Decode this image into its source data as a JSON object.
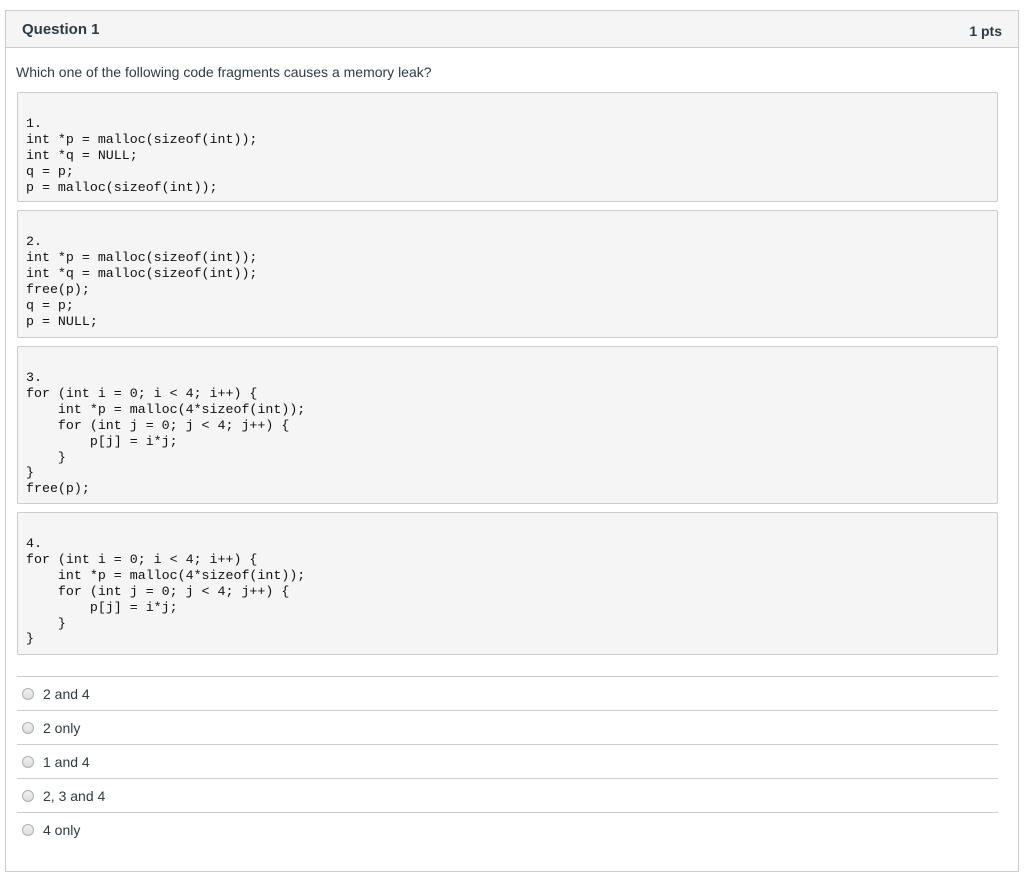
{
  "question": {
    "title": "Question 1",
    "points": "1 pts",
    "text": "Which one of the following code fragments causes a memory leak?"
  },
  "code_blocks": [
    "1.\nint *p = malloc(sizeof(int));\nint *q = NULL;\nq = p;\np = malloc(sizeof(int));",
    "2.\nint *p = malloc(sizeof(int));\nint *q = malloc(sizeof(int));\nfree(p);\nq = p;\np = NULL;",
    "3.\nfor (int i = 0; i < 4; i++) {\n    int *p = malloc(4*sizeof(int));\n    for (int j = 0; j < 4; j++) {\n        p[j] = i*j;\n    }\n}\nfree(p);",
    "4.\nfor (int i = 0; i < 4; i++) {\n    int *p = malloc(4*sizeof(int));\n    for (int j = 0; j < 4; j++) {\n        p[j] = i*j;\n    }\n}"
  ],
  "answers": [
    {
      "label": "2 and 4"
    },
    {
      "label": "2 only"
    },
    {
      "label": "1 and 4"
    },
    {
      "label": "2, 3 and 4"
    },
    {
      "label": "4 only"
    }
  ]
}
